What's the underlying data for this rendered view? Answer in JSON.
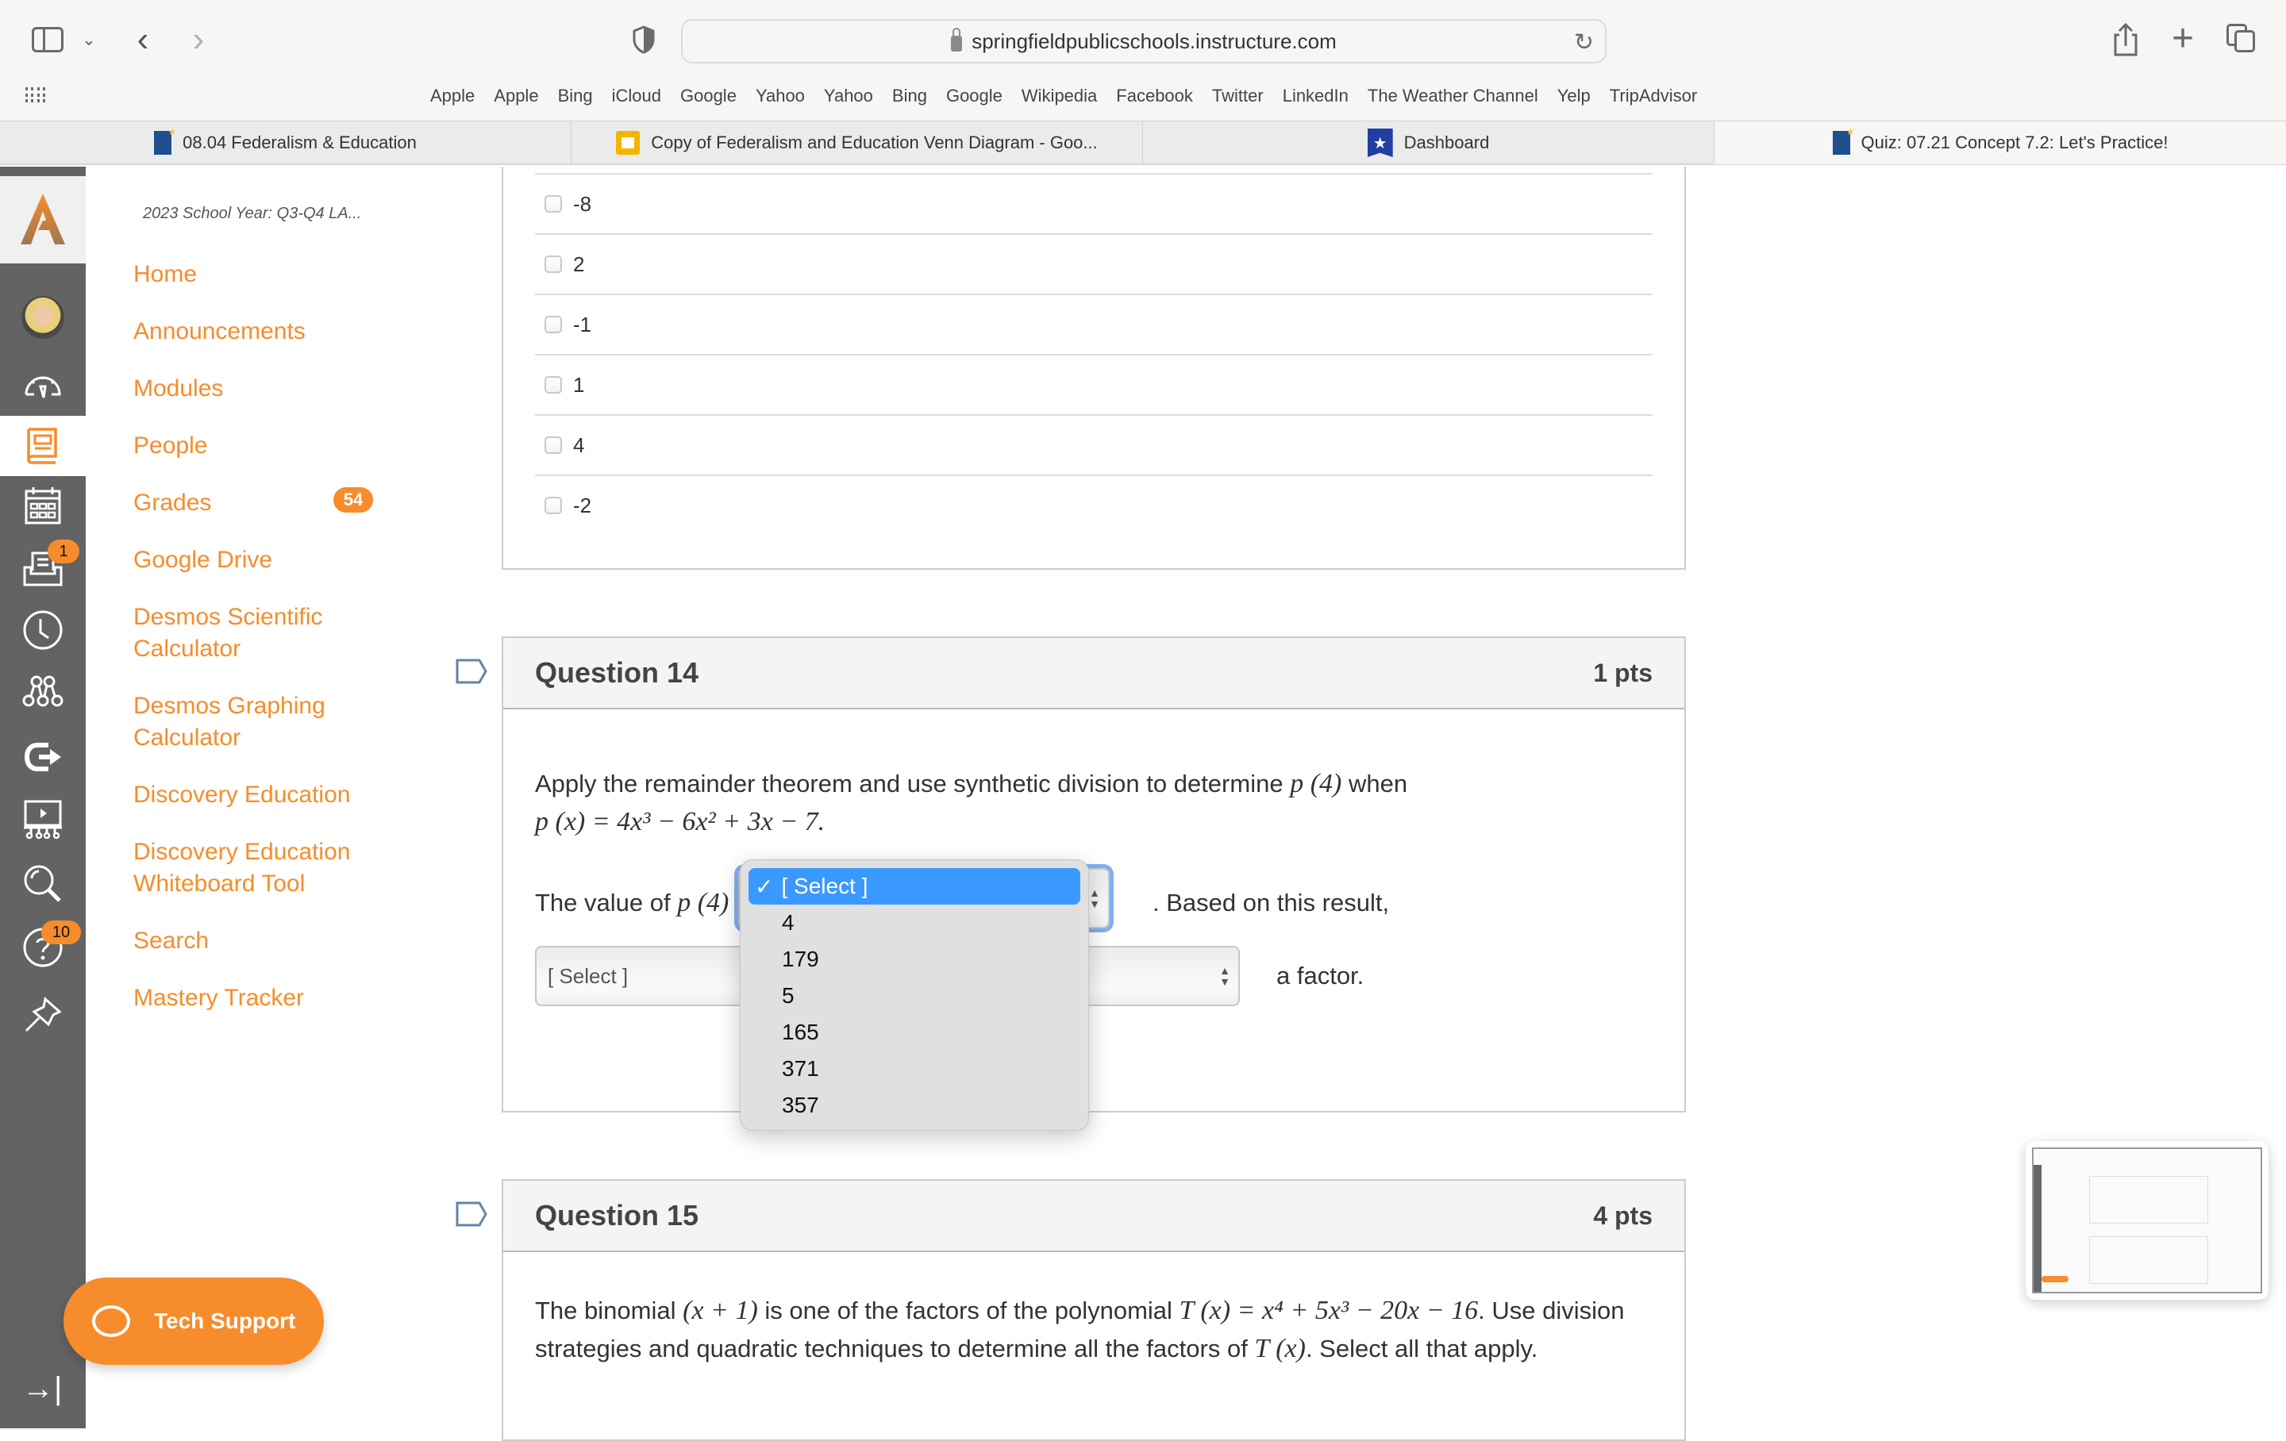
{
  "browser": {
    "url": "springfieldpublicschools.instructure.com",
    "bookmarks": [
      "Apple",
      "Apple",
      "Bing",
      "iCloud",
      "Google",
      "Yahoo",
      "Yahoo",
      "Bing",
      "Google",
      "Wikipedia",
      "Facebook",
      "Twitter",
      "LinkedIn",
      "The Weather Channel",
      "Yelp",
      "TripAdvisor"
    ],
    "tabs": [
      {
        "label": "08.04 Federalism & Education",
        "icon": "sps-logo-icon",
        "active": false
      },
      {
        "label": "Copy of Federalism and Education Venn Diagram - Goo...",
        "icon": "google-slides-icon",
        "active": false
      },
      {
        "label": "Dashboard",
        "icon": "dashboard-shield-icon",
        "active": false
      },
      {
        "label": "Quiz: 07.21 Concept 7.2: Let's Practice!",
        "icon": "sps-logo-icon",
        "active": true
      }
    ]
  },
  "global_nav": {
    "items": [
      {
        "name": "account",
        "icon": "avatar"
      },
      {
        "name": "dashboard",
        "icon": "dashboard-gauge-icon"
      },
      {
        "name": "courses",
        "icon": "courses-book-icon",
        "active": true
      },
      {
        "name": "calendar",
        "icon": "calendar-icon"
      },
      {
        "name": "inbox",
        "icon": "inbox-icon",
        "badge": "1"
      },
      {
        "name": "history",
        "icon": "clock-icon"
      },
      {
        "name": "commons",
        "icon": "commons-icon"
      },
      {
        "name": "portal",
        "icon": "portal-arrow-icon"
      },
      {
        "name": "studio",
        "icon": "studio-icon"
      },
      {
        "name": "search",
        "icon": "search-icon"
      },
      {
        "name": "help",
        "icon": "help-icon",
        "badge": "10"
      },
      {
        "name": "pin",
        "icon": "pin-icon"
      }
    ],
    "collapse_icon": "collapse-nav-icon"
  },
  "course_nav": {
    "course_title": "2023 School Year: Q3-Q4 LA...",
    "items": [
      {
        "label": "Home"
      },
      {
        "label": "Announcements"
      },
      {
        "label": "Modules"
      },
      {
        "label": "People"
      },
      {
        "label": "Grades",
        "badge": "54"
      },
      {
        "label": "Google Drive"
      },
      {
        "label": "Desmos Scientific Calculator"
      },
      {
        "label": "Desmos Graphing Calculator"
      },
      {
        "label": "Discovery Education"
      },
      {
        "label": "Discovery Education Whiteboard Tool"
      },
      {
        "label": "Search"
      },
      {
        "label": "Mastery Tracker"
      }
    ]
  },
  "tech_support": {
    "label": "Tech Support"
  },
  "previous_question": {
    "answers": [
      "-8",
      "2",
      "-1",
      "1",
      "4",
      "-2"
    ]
  },
  "question14": {
    "title": "Question 14",
    "points": "1 pts",
    "text_a": "Apply the remainder theorem and use synthetic division to determine ",
    "math_p4": "p (4)",
    "text_b": " when",
    "equation": "p (x) = 4x³ − 6x² + 3x − 7.",
    "value_prefix": "The value of ",
    "value_suffix": ". Based on this result,",
    "factor_suffix": "a factor.",
    "select1": {
      "selected": "[ Select ]",
      "options": [
        "[ Select ]",
        "4",
        "179",
        "5",
        "165",
        "371",
        "357"
      ]
    },
    "select2": {
      "selected": "[ Select ]"
    }
  },
  "question15": {
    "title": "Question 15",
    "points": "4 pts",
    "text_a": "The binomial ",
    "math_binomial": "(x + 1)",
    "text_b": " is  one of the factors of the polynomial ",
    "math_poly": "T (x) = x⁴ + 5x³ − 20x − 16",
    "text_c": ". Use division strategies and quadratic techniques to determine all the factors of ",
    "math_T": "T (x)",
    "text_d": ". Select all that apply."
  }
}
